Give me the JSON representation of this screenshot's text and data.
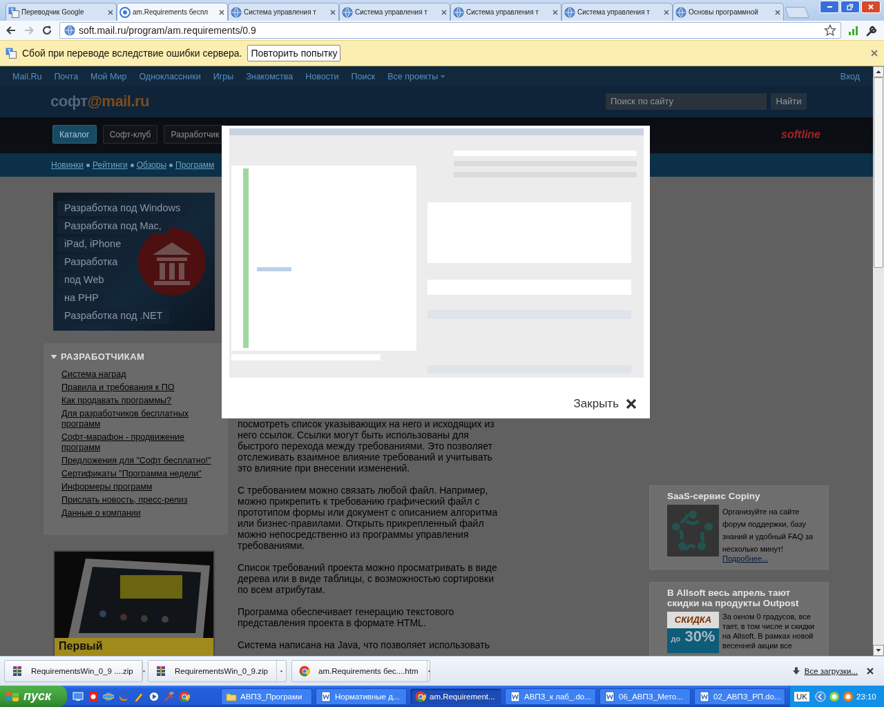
{
  "browser": {
    "tabs": [
      {
        "title": "Переводчик Google",
        "kind": "translate",
        "selected": false
      },
      {
        "title": "am.Requirements беспл",
        "kind": "page",
        "selected": true
      },
      {
        "title": "Система управления т",
        "kind": "globe",
        "selected": false
      },
      {
        "title": "Система управления т",
        "kind": "globe",
        "selected": false
      },
      {
        "title": "Система управления т",
        "kind": "globe",
        "selected": false
      },
      {
        "title": "Система управления т",
        "kind": "globe",
        "selected": false
      },
      {
        "title": "Основы программной",
        "kind": "globe",
        "selected": false
      }
    ],
    "address": "soft.mail.ru/program/am.requirements/0.9"
  },
  "translate_bar": {
    "message": "Сбой при переводе вследствие ошибки сервера.",
    "retry_button": "Повторить попытку"
  },
  "site": {
    "nav": [
      "Mail.Ru",
      "Почта",
      "Мой Мир",
      "Одноклассники",
      "Игры",
      "Знакомства",
      "Новости",
      "Поиск"
    ],
    "all_projects": "Все проекты",
    "login": "Вход",
    "logo": {
      "prefix": "софт",
      "suffix": "@mail.ru"
    },
    "search": {
      "placeholder": "Поиск по сайту",
      "button": "Найти"
    },
    "catalog_tabs": [
      {
        "label": "Каталог",
        "selected": true
      },
      {
        "label": "Софт-клуб",
        "selected": false
      },
      {
        "label": "Разработчик",
        "selected": false
      }
    ],
    "partner_logo": "softline",
    "subnav": [
      "Новинки",
      "Рейтинги",
      "Обзоры",
      "Программ"
    ],
    "banner": {
      "lines": [
        "Разработка под Windows",
        "Разработка под Mac,",
        "iPad, iPhone",
        "Разработка",
        "под Web",
        "на PHP",
        "Разработка под .NET"
      ]
    },
    "sidebar": {
      "heading": "РАЗРАБОТЧИКАМ",
      "links": [
        "Система наград",
        "Правила и требования к ПО",
        "Как продавать программы?",
        "Для разработчиков бесплатных программ",
        "Софт-марафон - продвижение программ",
        "Предложения для \"Софт бесплатно!\"",
        "Сертификаты \"Программа недели\"",
        "Информеры программ",
        "Прислать новость, пресс-релиз",
        "Данные о компании"
      ]
    },
    "phone_ad": {
      "caption": "Первый"
    },
    "article": {
      "paragraphs": [
        "посмотреть список указывающих на него и исходящих из него ссылок. Ссылки могут быть использованы для быстрого перехода между требованиями. Это позволяет отслеживать взаимное влияние требований и учитывать это влияние при внесении изменений.",
        "С требованием можно связать любой файл. Например, можно прикрепить к требованию графический файл с прототипом формы или документ с описанием алгоритма или бизнес-правилами. Открыть прикрепленный файл можно непосредственно из программы управления требованиями.",
        "Список требований проекта можно просматривать в виде дерева или в виде таблицы, с возможностью сортировки по всем атрибутам.",
        "Программа обеспечивает генерацию текстового представления проекта в формате HTML.",
        "Система написана на Java, что позволяет использовать"
      ]
    },
    "ads": [
      {
        "kind": "copiny",
        "title": "SaaS-сервис Copiny",
        "text": "Организуйте на сайте форум поддержки, базу знаний и удобный FAQ за несколько минут!",
        "link": "Подробнее..."
      },
      {
        "kind": "discount",
        "title": "В Allsoft весь апрель тают скидки на продукты Outpost",
        "text": "За окном 0 градусов, все тает, в том числе и скидки на Allsoft. В рамках новой весенней акции все",
        "badge": {
          "top": "СКИДКА",
          "prefix": "до",
          "value": "30%"
        }
      }
    ]
  },
  "modal": {
    "close_label": "Закрыть"
  },
  "downloads": {
    "items": [
      {
        "name": "RequirementsWin_0_9 ....zip",
        "kind": "archive"
      },
      {
        "name": "RequirementsWin_0_9.zip",
        "kind": "archive"
      },
      {
        "name": "am.Requirements бес....htm",
        "kind": "page"
      }
    ],
    "all_link": "Все загрузки..."
  },
  "taskbar": {
    "start": "пуск",
    "tasks": [
      {
        "label": "АВПЗ_Програми",
        "kind": "folder",
        "selected": false
      },
      {
        "label": "Нормативные д...",
        "kind": "word",
        "selected": false
      },
      {
        "label": "am.Requirement...",
        "kind": "browser",
        "selected": true
      },
      {
        "label": "АВПЗ_к лаб_.do...",
        "kind": "word",
        "selected": false
      },
      {
        "label": "06_АВПЗ_Мето...",
        "kind": "word",
        "selected": false
      },
      {
        "label": "02_АВПЗ_РП.do...",
        "kind": "word",
        "selected": false
      }
    ],
    "language": "UK",
    "clock": "23:10"
  }
}
